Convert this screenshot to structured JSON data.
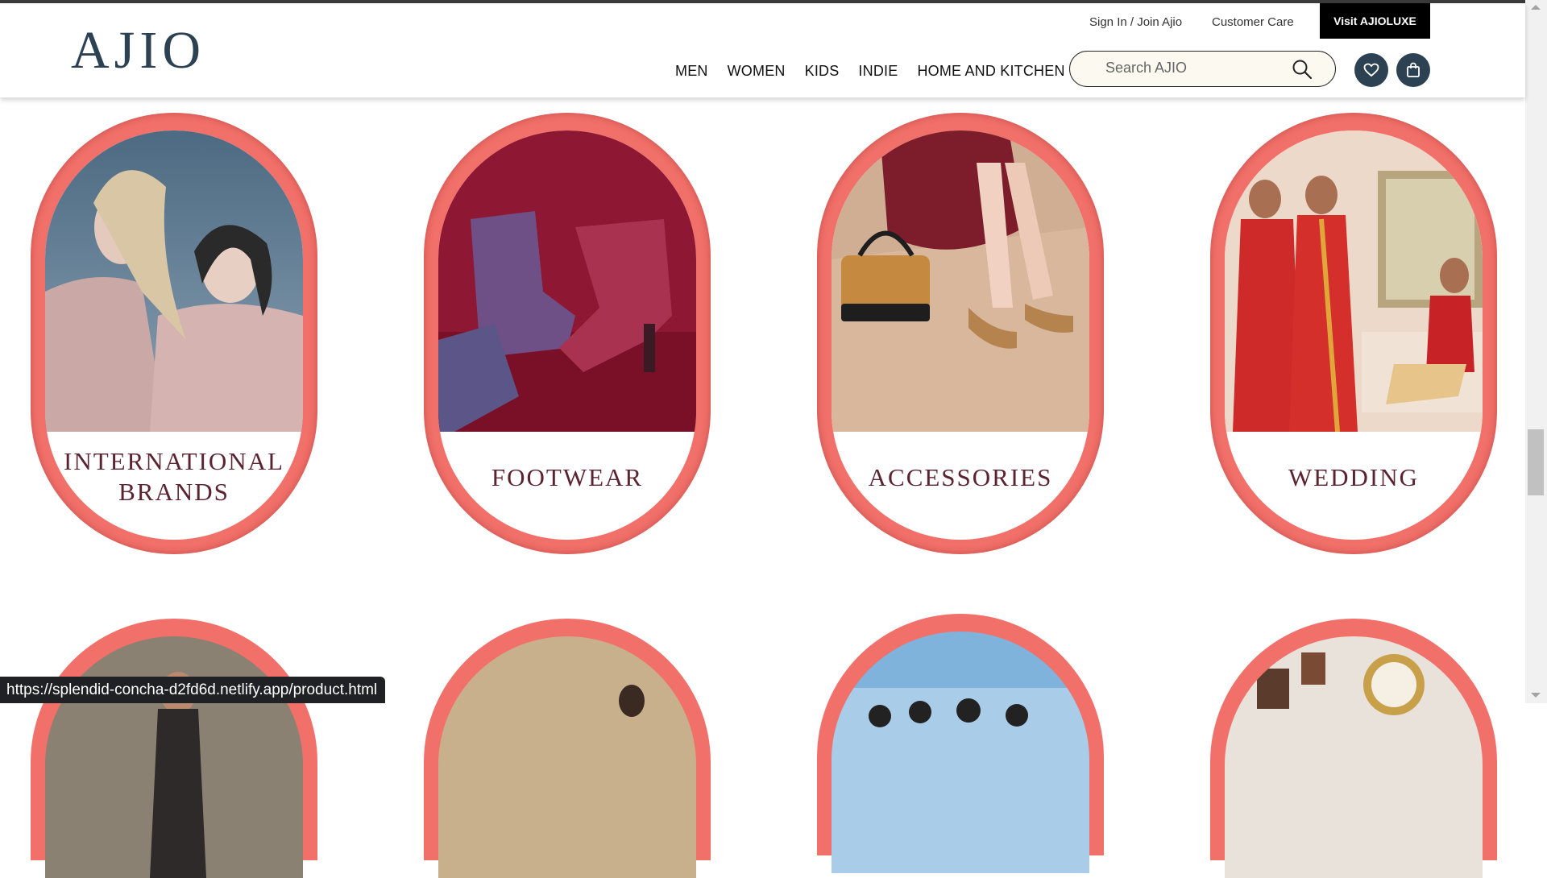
{
  "header": {
    "logo": "AJIO",
    "sign_in": "Sign In / Join Ajio",
    "customer_care": "Customer Care",
    "luxe_button": "Visit AJIOLUXE",
    "nav": [
      "MEN",
      "WOMEN",
      "KIDS",
      "INDIE",
      "HOME AND KITCHEN"
    ],
    "search_placeholder": "Search AJIO",
    "icons": {
      "search": "search-icon",
      "wishlist": "heart-icon",
      "bag": "shopping-bag-icon"
    }
  },
  "categories": [
    {
      "line1": "INTERNATIONAL",
      "line2": "BRANDS"
    },
    {
      "line1": "FOOTWEAR"
    },
    {
      "line1": "ACCESSORIES"
    },
    {
      "line1": "WEDDING"
    }
  ],
  "colors": {
    "frame": "#f2706a",
    "label": "#5b2330",
    "brand": "#2c4152"
  },
  "status_url": "https://splendid-concha-d2fd6d.netlify.app/product.html"
}
